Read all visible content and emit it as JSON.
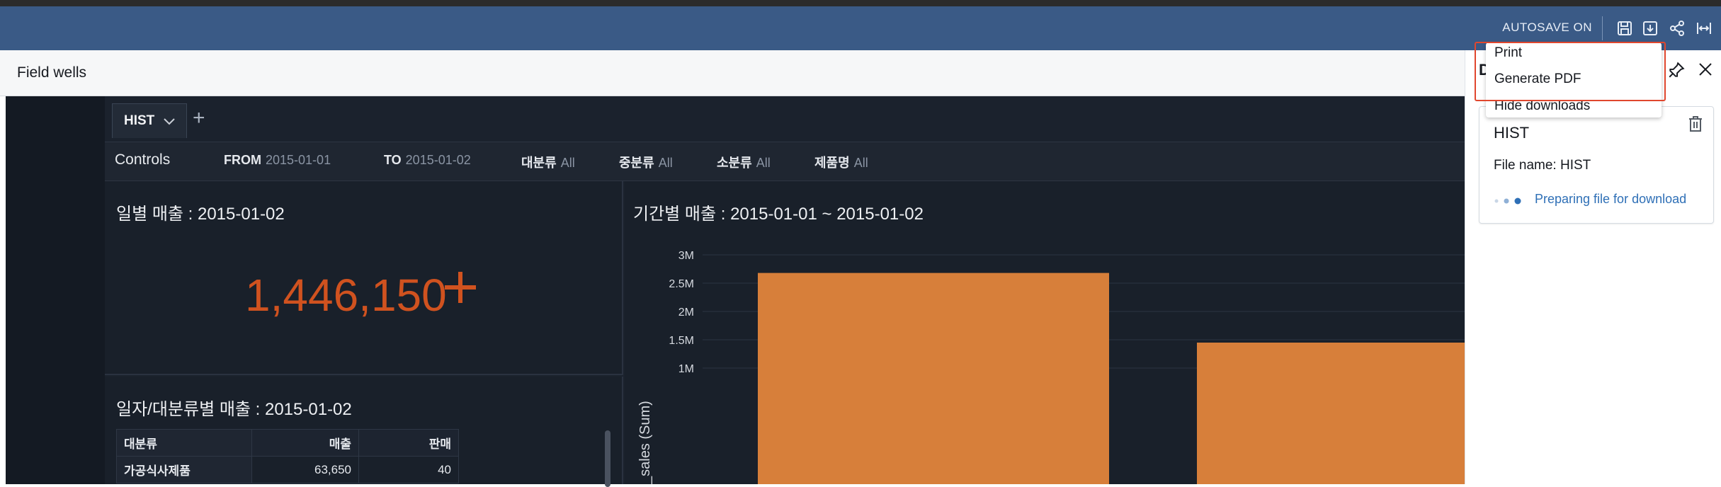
{
  "toolbar": {
    "autosave_label": "AUTOSAVE ON",
    "icons": [
      "save-icon",
      "download-icon",
      "share-icon",
      "fit-width-icon"
    ]
  },
  "field_wells": {
    "label": "Field wells"
  },
  "sheet_tabs": {
    "active_tab": "HIST",
    "add_label": "+"
  },
  "controls": {
    "label": "Controls",
    "items": [
      {
        "key": "FROM",
        "value": "2015-01-01"
      },
      {
        "key": "TO",
        "value": "2015-01-02"
      },
      {
        "key": "대분류",
        "value": "All"
      },
      {
        "key": "중분류",
        "value": "All"
      },
      {
        "key": "소분류",
        "value": "All"
      },
      {
        "key": "제품명",
        "value": "All"
      }
    ]
  },
  "kpi_visual": {
    "title": "일별 매출 : 2015-01-02",
    "value": "1,446,150",
    "accent": "#d0521f"
  },
  "table_visual": {
    "title": "일자/대분류별 매출 : 2015-01-02",
    "headers": [
      "대분류",
      "매출",
      "판매"
    ],
    "rows": [
      [
        "가공식사제품",
        "63,650",
        "40"
      ]
    ]
  },
  "chart_visual": {
    "title": "기간별 매출 : 2015-01-01 ~ 2015-01-02"
  },
  "chart_data": {
    "type": "bar",
    "title": "기간별 매출 : 2015-01-01 ~ 2015-01-02",
    "ylabel": "_sales (Sum)",
    "categories": [
      "",
      ""
    ],
    "values": [
      2680000,
      1450000
    ],
    "ylim": [
      0,
      3000000
    ],
    "y_ticks": [
      "3M",
      "2.5M",
      "2M",
      "1.5M",
      "1M"
    ],
    "y_tick_values": [
      3000000,
      2500000,
      2000000,
      1500000,
      1000000
    ],
    "bar_color": "#d77f3a",
    "grid": true
  },
  "downloads_panel": {
    "header_initial": "D",
    "item": {
      "title": "HIST",
      "file_name": "File name: HIST",
      "status": "Preparing file for download"
    }
  },
  "download_menu": {
    "items": [
      "Print",
      "Generate PDF",
      "Hide downloads"
    ]
  }
}
